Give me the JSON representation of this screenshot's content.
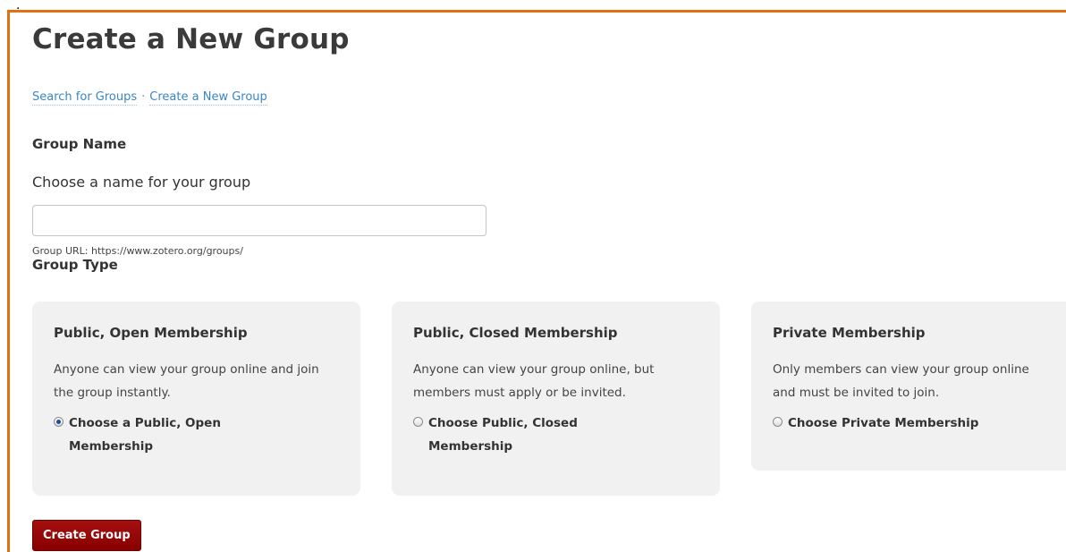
{
  "stray_mark": ".",
  "page": {
    "title": "Create a New Group"
  },
  "breadcrumb": {
    "items": [
      {
        "label": "Search for Groups"
      },
      {
        "label": "Create a New Group"
      }
    ],
    "separator": "·"
  },
  "group_name": {
    "heading": "Group Name",
    "field_label": "Choose a name for your group",
    "value": "",
    "placeholder": "",
    "url_hint": "Group URL: https://www.zotero.org/groups/"
  },
  "group_type": {
    "heading": "Group Type",
    "options": [
      {
        "title": "Public, Open Membership",
        "description": "Anyone can view your group online and join the group instantly.",
        "choice_label": "Choose a Public, Open Membership",
        "selected": true
      },
      {
        "title": "Public, Closed Membership",
        "description": "Anyone can view your group online, but members must apply or be invited.",
        "choice_label": "Choose Public, Closed Membership",
        "selected": false
      },
      {
        "title": "Private Membership",
        "description": "Only members can view your group online and must be invited to join.",
        "choice_label": "Choose Private Membership",
        "selected": false
      }
    ]
  },
  "actions": {
    "create_label": "Create Group"
  },
  "colors": {
    "frame_accent": "#e07213",
    "link": "#3b86c4",
    "button": "#9a0b0b",
    "card_bg": "#f1f1f1"
  }
}
